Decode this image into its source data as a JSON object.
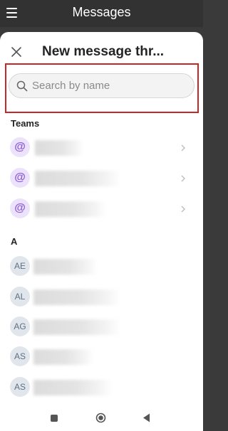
{
  "app_bar": {
    "title": "Messages",
    "menu_icon": "hamburger-menu-icon"
  },
  "sheet": {
    "title": "New message thr...",
    "close_icon": "close-icon"
  },
  "search": {
    "placeholder": "Search by name",
    "value": "",
    "icon": "search-icon"
  },
  "teams": {
    "label": "Teams",
    "items": [
      {
        "avatar": "@"
      },
      {
        "avatar": "@"
      },
      {
        "avatar": "@"
      }
    ]
  },
  "contacts": {
    "label": "A",
    "items": [
      {
        "initials": "AE"
      },
      {
        "initials": "AL"
      },
      {
        "initials": "AG"
      },
      {
        "initials": "AS"
      },
      {
        "initials": "AS"
      }
    ]
  },
  "colors": {
    "app_bar": "#323232",
    "highlight": "#c62828",
    "team_avatar_bg": "#ece2fb",
    "team_avatar_fg": "#8b5cd6",
    "person_avatar_bg": "#e1e6ec"
  }
}
